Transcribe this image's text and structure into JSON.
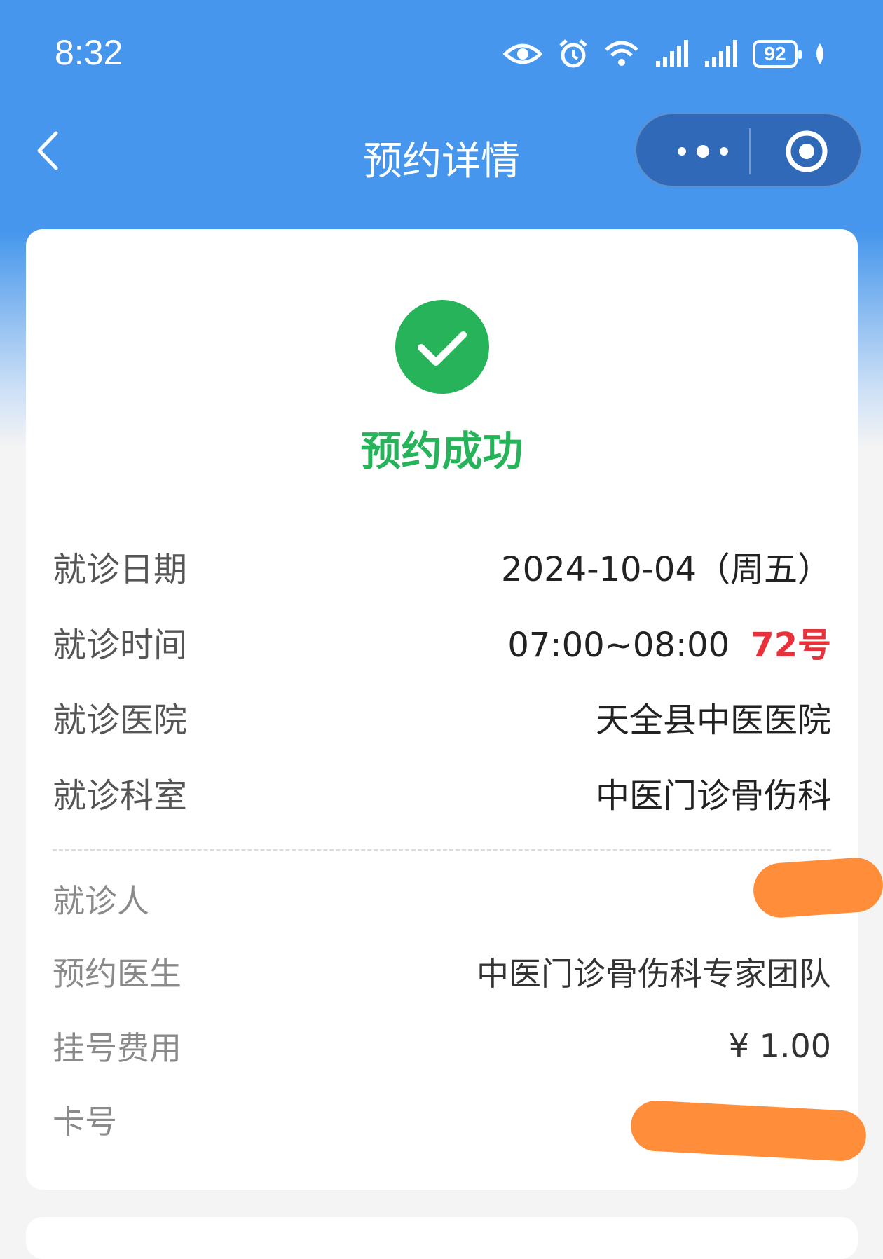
{
  "status_bar": {
    "time": "8:32",
    "battery": "92",
    "icons": [
      "eye-icon",
      "alarm-icon",
      "wifi-icon",
      "signal-icon",
      "signal-icon",
      "battery-icon",
      "leaf-icon"
    ]
  },
  "nav": {
    "title": "预约详情",
    "back_icon": "chevron-left-icon",
    "more_icon": "more-dots-icon",
    "close_icon": "target-icon"
  },
  "result": {
    "icon": "check-circle-icon",
    "text": "预约成功",
    "color": "#26b35a"
  },
  "details": {
    "date_label": "就诊日期",
    "date_value": "2024-10-04（周五）",
    "time_label": "就诊时间",
    "time_value": "07:00~08:00",
    "ticket_number": "72号",
    "hospital_label": "就诊医院",
    "hospital_value": "天全县中医医院",
    "dept_label": "就诊科室",
    "dept_value": "中医门诊骨伤科"
  },
  "extra": {
    "patient_label": "就诊人",
    "doctor_label": "预约医生",
    "doctor_value": "中医门诊骨伤科专家团队",
    "fee_label": "挂号费用",
    "fee_value": "¥ 1.00",
    "card_label": "卡号"
  },
  "colors": {
    "header_blue": "#4596ec",
    "success_green": "#26b35a",
    "ticket_red": "#e8313a",
    "redaction_orange": "#ff8d3a"
  }
}
